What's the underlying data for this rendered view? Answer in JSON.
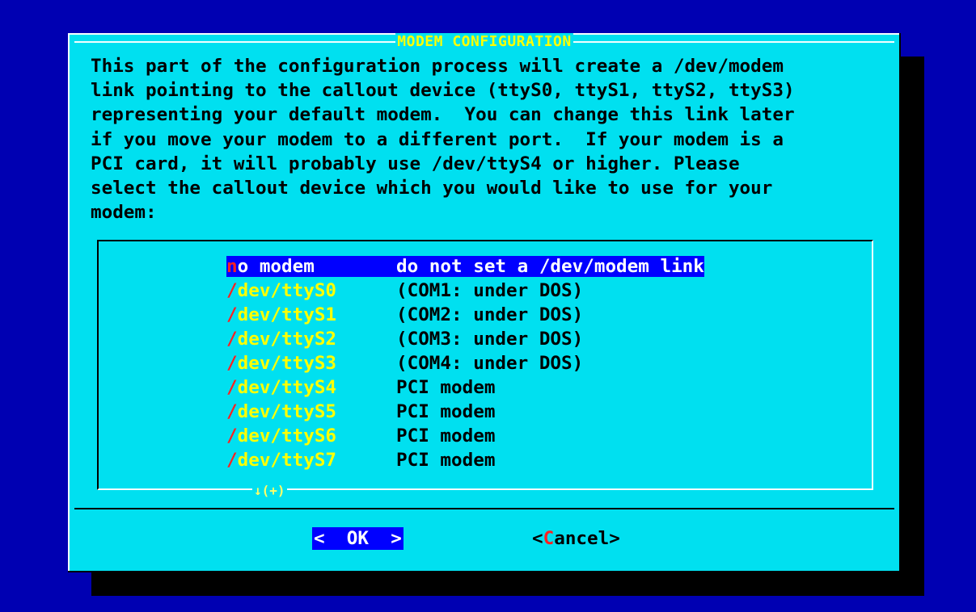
{
  "dialog": {
    "title": "MODEM CONFIGURATION",
    "message": "This part of the configuration process will create a /dev/modem\nlink pointing to the callout device (ttyS0, ttyS1, ttyS2, ttyS3)\nrepresenting your default modem.  You can change this link later\nif you move your modem to a different port.  If your modem is a\nPCI card, it will probably use /dev/ttyS4 or higher. Please\nselect the callout device which you would like to use for your\nmodem:",
    "more_indicator": "↓(+)"
  },
  "options": [
    {
      "tag_first": "n",
      "tag_rest": "o modem",
      "desc": "do not set a /dev/modem link",
      "selected": true
    },
    {
      "tag_first": "/",
      "tag_rest": "dev/ttyS0",
      "desc": "(COM1: under DOS)",
      "selected": false
    },
    {
      "tag_first": "/",
      "tag_rest": "dev/ttyS1",
      "desc": "(COM2: under DOS)",
      "selected": false
    },
    {
      "tag_first": "/",
      "tag_rest": "dev/ttyS2",
      "desc": "(COM3: under DOS)",
      "selected": false
    },
    {
      "tag_first": "/",
      "tag_rest": "dev/ttyS3",
      "desc": "(COM4: under DOS)",
      "selected": false
    },
    {
      "tag_first": "/",
      "tag_rest": "dev/ttyS4",
      "desc": "PCI modem",
      "selected": false
    },
    {
      "tag_first": "/",
      "tag_rest": "dev/ttyS5",
      "desc": "PCI modem",
      "selected": false
    },
    {
      "tag_first": "/",
      "tag_rest": "dev/ttyS6",
      "desc": "PCI modem",
      "selected": false
    },
    {
      "tag_first": "/",
      "tag_rest": "dev/ttyS7",
      "desc": "PCI modem",
      "selected": false
    }
  ],
  "buttons": {
    "ok_label": "<  OK  >",
    "cancel_open": "<",
    "cancel_hot": "C",
    "cancel_rest": "ancel>"
  },
  "colors": {
    "screen_bg": "#0000b2",
    "dialog_bg": "#00e0f0",
    "title": "#ffff00",
    "selection_bg": "#0000ff",
    "hotkey": "#ff2020"
  }
}
